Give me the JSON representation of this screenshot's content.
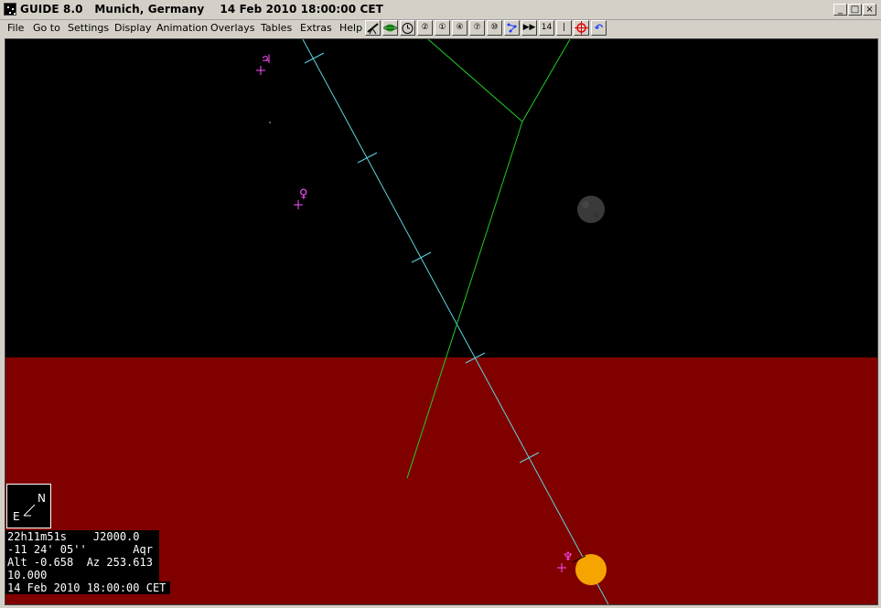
{
  "window": {
    "title": "GUIDE 8.0   Munich, Germany    14 Feb 2010 18:00:00 CET",
    "minimize_label": "_",
    "maximize_label": "□",
    "close_label": "×"
  },
  "menu": {
    "items": [
      "File",
      "Go to",
      "Settings",
      "Display",
      "Animation",
      "Overlays",
      "Tables",
      "Extras",
      "Help"
    ]
  },
  "toolbar": {
    "zoom_buttons": [
      "②",
      "①",
      "④",
      "⑦",
      "⑩"
    ],
    "level_label": "14",
    "separator_label": "|",
    "play_label": "▶▶",
    "undo_label": "↶"
  },
  "colors": {
    "sky": "#000000",
    "horizon_ground": "#800000",
    "ecliptic": "#5fd3e0",
    "green_line": "#22cc22",
    "planet_symbol": "#ff4fff",
    "sun": "#f5a400",
    "moon": "#3a3a3a"
  },
  "chart": {
    "planets": [
      {
        "name_symbol": "♃",
        "icon": "jupiter-symbol"
      },
      {
        "name_symbol": "♀",
        "icon": "venus-symbol"
      },
      {
        "name_symbol": "♆",
        "icon": "neptune-symbol"
      }
    ],
    "compass": {
      "north": "N",
      "east": "E"
    }
  },
  "info": {
    "ra_epoch": "22h11m51s    J2000.0",
    "dec_const": "-11 24' 05''       Aqr",
    "alt_az": "Alt -0.658  Az 253.613",
    "field": "10.000",
    "datetime": "14 Feb 2010 18:00:00 CET"
  }
}
